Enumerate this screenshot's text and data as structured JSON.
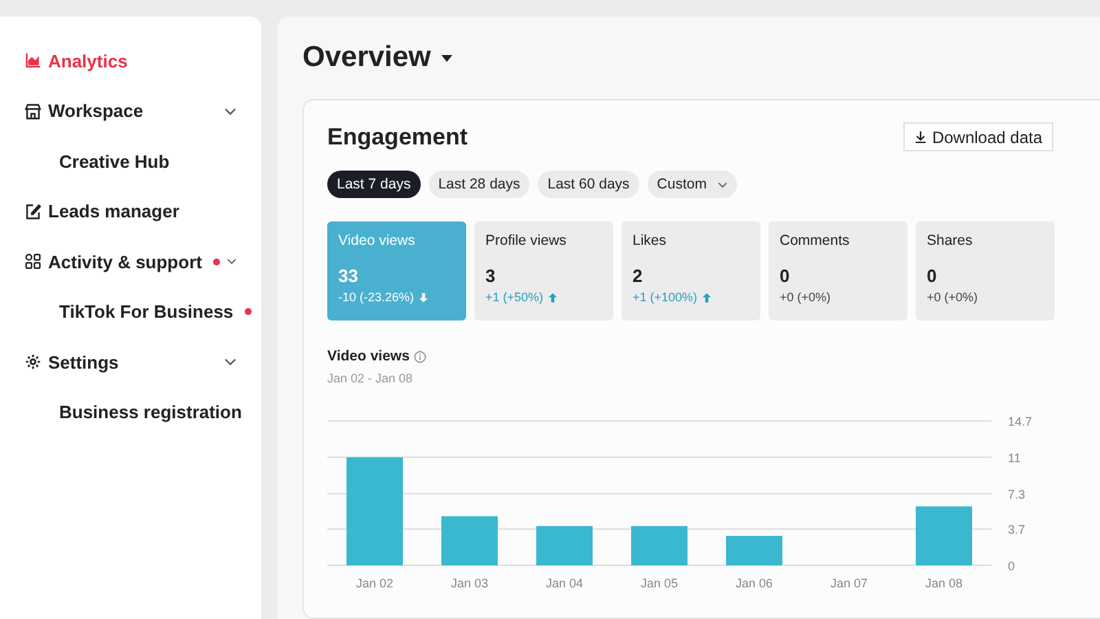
{
  "sidebar": {
    "items": [
      {
        "label": "Analytics",
        "selected": true,
        "badge": false
      },
      {
        "label": "Workspace",
        "selected": false,
        "badge": false,
        "expanded": true,
        "children": [
          {
            "label": "Creative Hub",
            "selected": false,
            "badge": false
          }
        ]
      },
      {
        "label": "Leads manager",
        "selected": false,
        "badge": false
      },
      {
        "label": "Activity & support",
        "selected": false,
        "badge": true,
        "expanded": true,
        "children": [
          {
            "label": "TikTok For Business",
            "selected": false,
            "badge": true
          }
        ]
      },
      {
        "label": "Settings",
        "selected": false,
        "badge": false,
        "expanded": true,
        "children": [
          {
            "label": "Business registration",
            "selected": false,
            "badge": false
          }
        ]
      }
    ]
  },
  "page_title": "Overview",
  "card": {
    "title": "Engagement",
    "download_button": "Download data",
    "ranges": [
      {
        "label": "Last 7 days",
        "selected": true,
        "dropdown": false
      },
      {
        "label": "Last 28 days",
        "selected": false,
        "dropdown": false
      },
      {
        "label": "Last 60 days",
        "selected": false,
        "dropdown": false
      },
      {
        "label": "Custom",
        "selected": false,
        "dropdown": true
      }
    ],
    "metrics": [
      {
        "label": "Video views",
        "value": "33",
        "delta": "-10 (-23.26%)",
        "kind": "down",
        "selected": true
      },
      {
        "label": "Profile views",
        "value": "3",
        "delta": "+1 (+50%)",
        "kind": "up",
        "selected": false
      },
      {
        "label": "Likes",
        "value": "2",
        "delta": "+1 (+100%)",
        "kind": "up",
        "selected": false
      },
      {
        "label": "Comments",
        "value": "0",
        "delta": "+0 (+0%)",
        "kind": "flat",
        "selected": false
      },
      {
        "label": "Shares",
        "value": "0",
        "delta": "+0 (+0%)",
        "kind": "flat",
        "selected": false
      }
    ],
    "chart_title": "Video views",
    "chart_subtitle": "Jan 02 - Jan 08",
    "chart_data": {
      "type": "bar",
      "categories": [
        "Jan 02",
        "Jan 03",
        "Jan 04",
        "Jan 05",
        "Jan 06",
        "Jan 07",
        "Jan 08"
      ],
      "series": [
        {
          "color": "#3ab8cf",
          "values": [
            11,
            5,
            4,
            4,
            3,
            0,
            6
          ]
        }
      ],
      "grid": true,
      "ylim": [
        0,
        14.7
      ],
      "yticks": [
        0,
        3.7,
        7.3,
        11,
        14.7
      ]
    }
  }
}
